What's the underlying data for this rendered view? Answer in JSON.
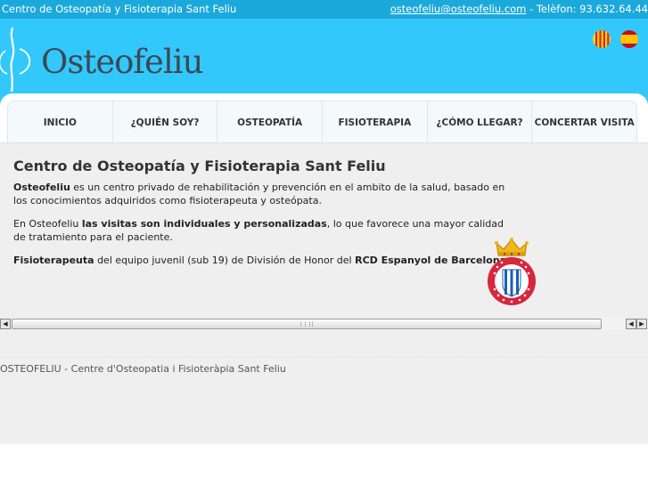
{
  "topbar": {
    "site_name": "Centro de Osteopatía y Fisioterapia Sant Feliu",
    "email": "osteofeliu@osteofeliu.com",
    "phone_text": " - Telèfon: 93.632.64.44"
  },
  "header": {
    "logo_text": "Osteofeliu",
    "flags": [
      "catalan-flag-icon",
      "spanish-flag-icon"
    ]
  },
  "nav": {
    "items": [
      {
        "label": "INICIO"
      },
      {
        "label": "¿QUIÉN SOY?"
      },
      {
        "label": "OSTEOPATÍA"
      },
      {
        "label": "FISIOTERAPIA"
      },
      {
        "label": "¿CÓMO LLEGAR?"
      },
      {
        "label": "CONCERTAR VISITA"
      }
    ]
  },
  "main": {
    "title": "Centro de Osteopatía y Fisioterapia Sant Feliu",
    "p1": {
      "bold": "Osteofeliu",
      "text": " es un centro privado de rehabilitación y prevención en el ambito de la salud, basado en los conocimientos adquiridos como fisioterapeuta y osteópata."
    },
    "p2": {
      "pre": "En Osteofeliu ",
      "bold": "las visitas son individuales y personalizadas",
      "post": ", lo que favorece una mayor calidad de tratamiento para el paciente."
    },
    "p3": {
      "bold1": "Fisioterapeuta",
      "mid": " del equipo juvenil (sub 19) de División de Honor del ",
      "bold2": "RCD Espanyol de Barcelona"
    },
    "crest_icon": "rcd-espanyol-crest-icon"
  },
  "footer": {
    "text": "OSTEOFELIU - Centre d'Osteopatia i Fisioteràpia Sant Feliu"
  },
  "colors": {
    "topbar": "#1ba9dc",
    "header": "#33c8fb",
    "content_bg": "#efefef"
  }
}
